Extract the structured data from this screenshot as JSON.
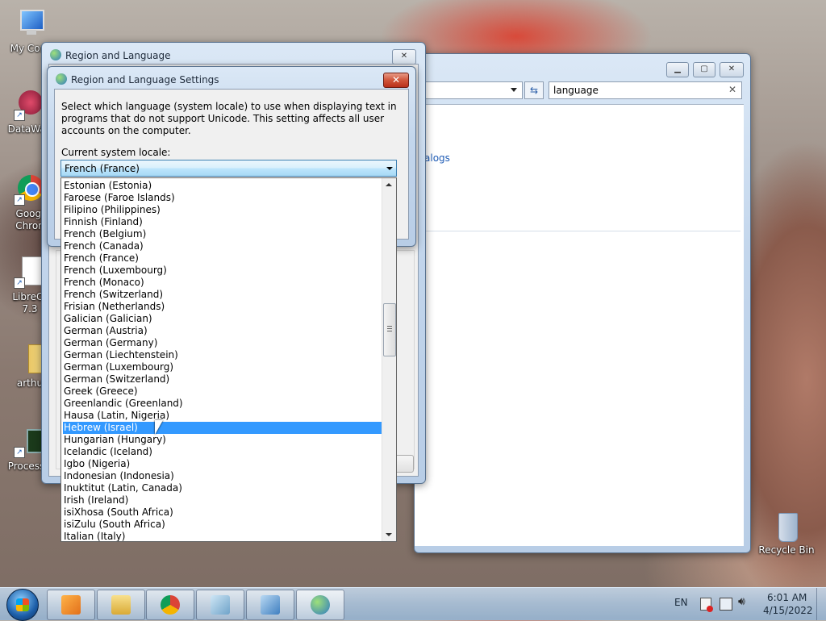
{
  "desktop": {
    "icons": [
      {
        "label": "My Com",
        "label2": ""
      },
      {
        "label": "DataWag",
        "label2": ""
      },
      {
        "label": "Googl",
        "label2": "Chron"
      },
      {
        "label": "LibreOf",
        "label2": "7.3"
      },
      {
        "label": "arthu",
        "label2": ""
      },
      {
        "label": "ProcessH",
        "label2": ""
      },
      {
        "label": "Recycle Bin",
        "label2": ""
      }
    ]
  },
  "control_panel": {
    "search_value": "language",
    "link_fragment": "alogs"
  },
  "region_window": {
    "title": "Region and Language"
  },
  "dialog": {
    "title": "Region and Language Settings",
    "description": "Select which language (system locale) to use when displaying text in programs that do not support Unicode. This setting affects all user accounts on the computer.",
    "locale_label": "Current system locale:",
    "current_locale": "French (France)",
    "options": [
      "Estonian (Estonia)",
      "Faroese (Faroe Islands)",
      "Filipino (Philippines)",
      "Finnish (Finland)",
      "French (Belgium)",
      "French (Canada)",
      "French (France)",
      "French (Luxembourg)",
      "French (Monaco)",
      "French (Switzerland)",
      "Frisian (Netherlands)",
      "Galician (Galician)",
      "German (Austria)",
      "German (Germany)",
      "German (Liechtenstein)",
      "German (Luxembourg)",
      "German (Switzerland)",
      "Greek (Greece)",
      "Greenlandic (Greenland)",
      "Hausa (Latin, Nigeria)",
      "Hebrew (Israel)",
      "Hungarian (Hungary)",
      "Icelandic (Iceland)",
      "Igbo (Nigeria)",
      "Indonesian (Indonesia)",
      "Inuktitut (Latin, Canada)",
      "Irish (Ireland)",
      "isiXhosa (South Africa)",
      "isiZulu (South Africa)",
      "Italian (Italy)"
    ],
    "highlighted": "Hebrew (Israel)"
  },
  "taskbar": {
    "language": "EN",
    "time": "6:01 AM",
    "date": "4/15/2022"
  },
  "colors": {
    "selection": "#3399ff",
    "link": "#1e5bb5",
    "close_button": "#c8462e"
  }
}
